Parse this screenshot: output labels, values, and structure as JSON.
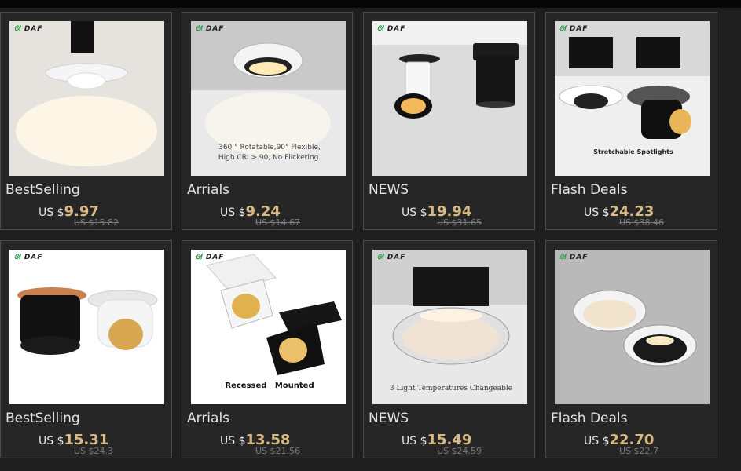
{
  "brand": {
    "logo_text": "DAF",
    "logo_icon": "leaf-dot-icon"
  },
  "colors": {
    "background": "#1e1e1e",
    "card": "#262626",
    "price_accent": "#d9b983",
    "old_price": "#7a7a7a",
    "brand_green": "#2d9b4a"
  },
  "currency_prefix": "US $",
  "products": [
    {
      "category": "BestSelling",
      "price": "9.97",
      "old_price": "US $15.82",
      "caption": ""
    },
    {
      "category": "Arrials",
      "price": "9.24",
      "old_price": "US $14.67",
      "caption": "360 ° Rotatable,90° Flexible,",
      "caption2": "High CRI > 90, No Flickering."
    },
    {
      "category": "NEWS",
      "price": "19.94",
      "old_price": "US $31.65",
      "caption": ""
    },
    {
      "category": "Flash Deals",
      "price": "24.23",
      "old_price": "US $38.46",
      "caption": "Stretchable Spotlights"
    },
    {
      "category": "BestSelling",
      "price": "15.31",
      "old_price": "US $24.3",
      "caption": ""
    },
    {
      "category": "Arrials",
      "price": "13.58",
      "old_price": "US $21.56",
      "caption": "Recessed   Mounted"
    },
    {
      "category": "NEWS",
      "price": "15.49",
      "old_price": "US $24.59",
      "caption": "3 Light Temperatures Changeable"
    },
    {
      "category": "Flash Deals",
      "price": "22.70",
      "old_price": "US $22.7",
      "caption": ""
    }
  ]
}
